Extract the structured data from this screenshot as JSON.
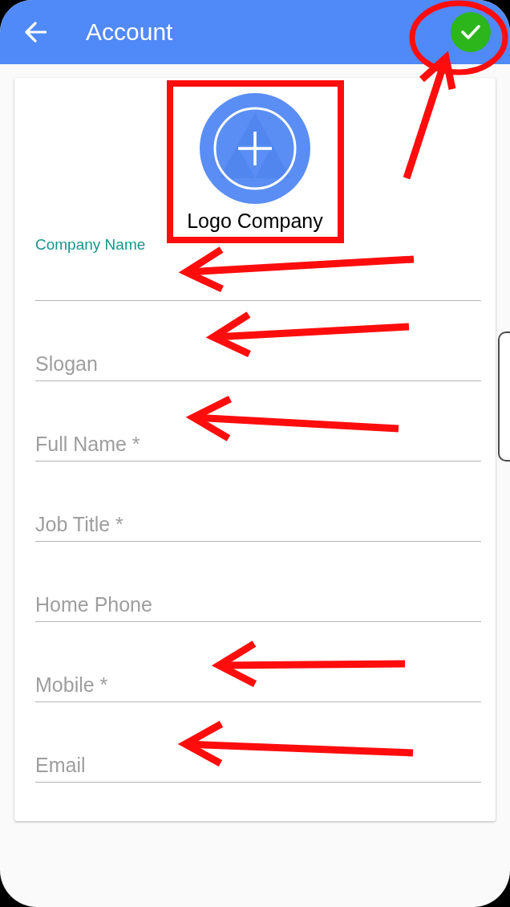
{
  "app_bar": {
    "title": "Account"
  },
  "logo": {
    "caption": "Logo Company"
  },
  "fields": [
    {
      "label": "Company Name",
      "focused": true
    },
    {
      "placeholder": "Slogan",
      "focused": false
    },
    {
      "placeholder": "Full Name *",
      "focused": false
    },
    {
      "placeholder": "Job Title *",
      "focused": false
    },
    {
      "placeholder": "Home Phone",
      "focused": false
    },
    {
      "placeholder": "Mobile *",
      "focused": false
    },
    {
      "placeholder": "Email",
      "focused": false
    }
  ],
  "annotations": [
    {
      "kind": "ellipse"
    },
    {
      "kind": "arrow"
    },
    {
      "kind": "rectangle"
    },
    {
      "kind": "arrow"
    },
    {
      "kind": "arrow"
    },
    {
      "kind": "arrow"
    },
    {
      "kind": "arrow"
    },
    {
      "kind": "arrow"
    }
  ]
}
